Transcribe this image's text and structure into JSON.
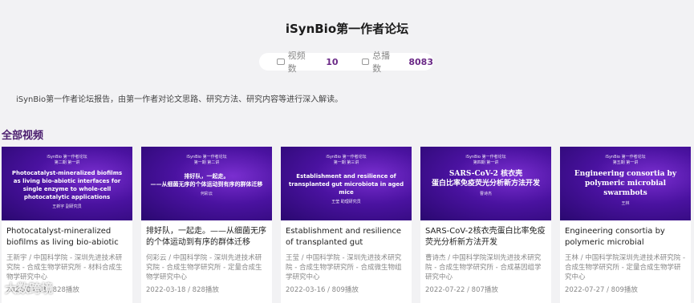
{
  "page": {
    "title": "iSynBio第一作者论坛",
    "stats": {
      "videos_label": "视频数",
      "videos_value": "10",
      "plays_label": "总播数",
      "plays_value": "8083"
    },
    "description": "iSynBio第一作者论坛报告，由第一作者对论文思路、研究方法、研究内容等进行深入解读。",
    "section_title": "全部视频"
  },
  "cards": [
    {
      "thumb_series": "iSynBio 第一作者论坛\n第二期 第一讲",
      "thumb_title": "Photocatalyst-mineralized biofilms as living bio-abiotic interfaces for single enzyme to whole-cell photocatalytic applications",
      "thumb_speaker": "王新宇 副研究员",
      "title": "Photocatalyst-mineralized biofilms as living bio-abiotic interfaces for...",
      "meta": "王新宇 / 中国科学院 - 深圳先进技术研究院 - 合成生物学研究所 - 材料合成生物学研究中心",
      "date": "2022-03-18 / 828播放"
    },
    {
      "thumb_series": "iSynBio 第一作者论坛\n第一期 第二讲",
      "thumb_title": "排好队，一起走。\n——从细菌无序的个体运动到有序的群体迁移",
      "thumb_speaker": "何彩云",
      "title": "排好队，一起走。——从细菌无序的个体运动到有序的群体迁移",
      "meta": "何彩云 / 中国科学院 - 深圳先进技术研究院 - 合成生物学研究所 - 定量合成生物学研究中心",
      "date": "2022-03-18 / 828播放"
    },
    {
      "thumb_series": "iSynBio 第一作者论坛\n第一期 第三讲",
      "thumb_title": "Establishment and resilience of transplanted gut microbiota in aged mice",
      "thumb_speaker": "王莹 助理研究员",
      "title": "Establishment and resilience of transplanted gut microbiota in ag...",
      "meta": "王莹 / 中国科学院 - 深圳先进技术研究院 - 合成生物学研究所 - 合成微生物组学研究中心",
      "date": "2022-03-16 / 809播放"
    },
    {
      "thumb_series": "iSynBio 第一作者论坛\n第四期 第一讲",
      "thumb_title": "SARS-CoV-2 核衣壳\n蛋白比率免疫荧光分析新方法开发",
      "thumb_speaker": "曹诗杰",
      "title": "SARS-CoV-2核衣壳蛋白比率免疫荧光分析新方法开发",
      "meta": "曹诗杰 / 中国科学院深圳先进技术研究院 - 合成生物学研究所 - 合成基因组学研究中心",
      "date": "2022-07-22 / 807播放"
    },
    {
      "thumb_series": "iSynBio 第一作者论坛\n第五期 第一讲",
      "thumb_title": "Engineering consortia by polymeric microbial swarmbots",
      "thumb_speaker": "王林",
      "title": "Engineering consortia by polymeric microbial swarmbots",
      "meta": "王林 / 中国科学院深圳先进技术研究院 - 合成生物学研究所 - 定量合成生物学研究中心",
      "date": "2022-07-27 / 809播放"
    }
  ],
  "watermark": "大数跨境"
}
